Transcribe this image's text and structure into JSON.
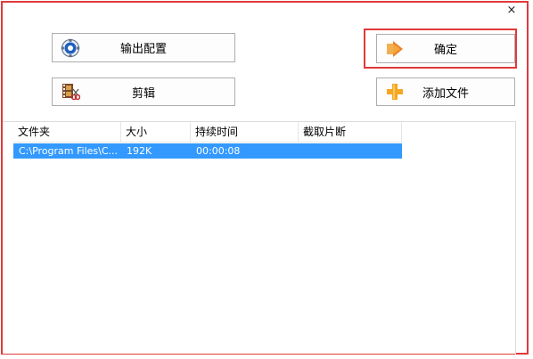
{
  "window": {
    "close_glyph": "×"
  },
  "buttons": {
    "output_config": {
      "label": "输出配置",
      "icon": "gear-disc-icon"
    },
    "confirm": {
      "label": "确定",
      "icon": "arrow-right-icon"
    },
    "edit": {
      "label": "剪辑",
      "icon": "film-scissors-icon"
    },
    "add_file": {
      "label": "添加文件",
      "icon": "plus-icon"
    }
  },
  "table": {
    "columns": [
      "文件夹",
      "大小",
      "持续时间",
      "截取片断"
    ],
    "rows": [
      {
        "folder": "C:\\Program Files\\C...",
        "size": "192K",
        "duration": "00:00:08",
        "clip": ""
      }
    ]
  },
  "colors": {
    "accent_red": "#e03a3a",
    "selection_blue": "#3399ff",
    "plus_orange": "#f5a623"
  }
}
